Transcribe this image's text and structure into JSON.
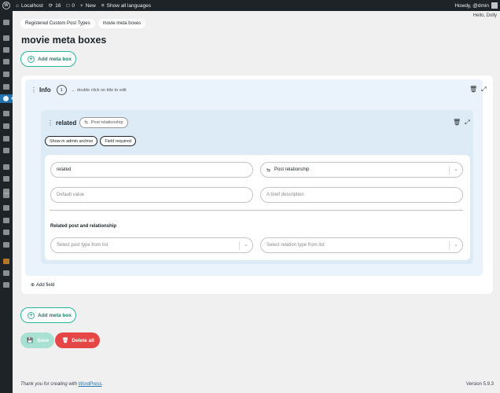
{
  "adminbar": {
    "site_name": "Localhost",
    "updates_count": "16",
    "comments_count": "0",
    "new_label": "New",
    "languages_label": "Show all languages",
    "greeting": "Howdy, @dmin"
  },
  "hello_text": "Hello, Dolly",
  "breadcrumb": {
    "items": [
      "Registered Custom Post Types",
      "movie meta boxes"
    ]
  },
  "page_title": "movie meta boxes",
  "add_meta_box_label": "Add meta box",
  "meta_box": {
    "title": "Info",
    "count": "1",
    "hint": "← double click on title to edit",
    "field": {
      "name": "related",
      "type_badge": "Post relationship",
      "show_in_admin_archive": "Show in admin archive",
      "field_required": "Field required",
      "name_value": "related",
      "type_select": "Post relationship",
      "default_placeholder": "Default value",
      "description_placeholder": "A brief description",
      "relationship_label": "Related post and relationship",
      "post_type_placeholder": "Select post type from list",
      "relation_type_placeholder": "Select relation type from list"
    },
    "add_field_label": "Add field"
  },
  "actions": {
    "save_label": "Save",
    "delete_all_label": "Delete all"
  },
  "footer": {
    "thanks_prefix": "Thank you for creating with ",
    "wordpress_link": "WordPress",
    "thanks_suffix": ".",
    "version": "Version 5.9.3"
  },
  "colors": {
    "accent_green": "#27b697",
    "danger_red": "#e64646",
    "wp_dark": "#1d2327",
    "wp_blue": "#2271b1"
  }
}
